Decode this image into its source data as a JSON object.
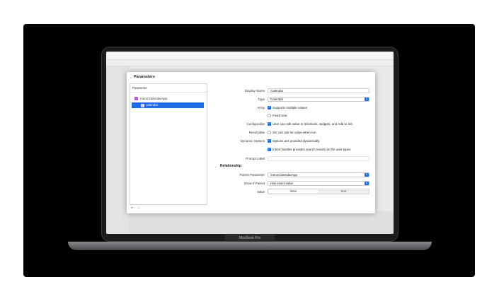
{
  "laptop": {
    "model_label": "MacBook Pro"
  },
  "dialog": {
    "title": "Parameters",
    "parameter_list": {
      "header": "Parameter",
      "items": [
        {
          "label": "mirrorCalendarApp"
        },
        {
          "label": "calendar"
        }
      ]
    },
    "fields": {
      "display_name": {
        "label": "Display Name",
        "value": "Calendar"
      },
      "type": {
        "label": "Type",
        "value": "Calendar"
      },
      "array": {
        "label": "Array",
        "checkbox_text": "Supports multiple values"
      },
      "fixed_size": {
        "checkbox_text": "Fixed size"
      },
      "configurable": {
        "label": "Configurable",
        "checkbox_text": "User can edit value in Shortcuts, widgets, and Add to Siri"
      },
      "resolvable": {
        "label": "Resolvable",
        "checkbox_text": "Siri can ask for value when run"
      },
      "dynamic_options": {
        "label": "Dynamic Options",
        "checkbox_text": "Options are provided dynamically"
      },
      "intent_handler": {
        "checkbox_text": "Intent handler provides search results as the user types"
      },
      "prompt_label": {
        "label": "Prompt Label"
      }
    },
    "relationship": {
      "title": "Relationship",
      "parent_parameter": {
        "label": "Parent Parameter",
        "value": "mirrorCalendarApp"
      },
      "show_if_parent": {
        "label": "Show If Parent",
        "value": "Has exact value"
      },
      "value": {
        "label": "Value",
        "options": [
          "false",
          "true"
        ]
      }
    },
    "footer": {
      "add": "+",
      "remove": "−"
    }
  },
  "colors": {
    "accent": "#1d6ee6"
  }
}
